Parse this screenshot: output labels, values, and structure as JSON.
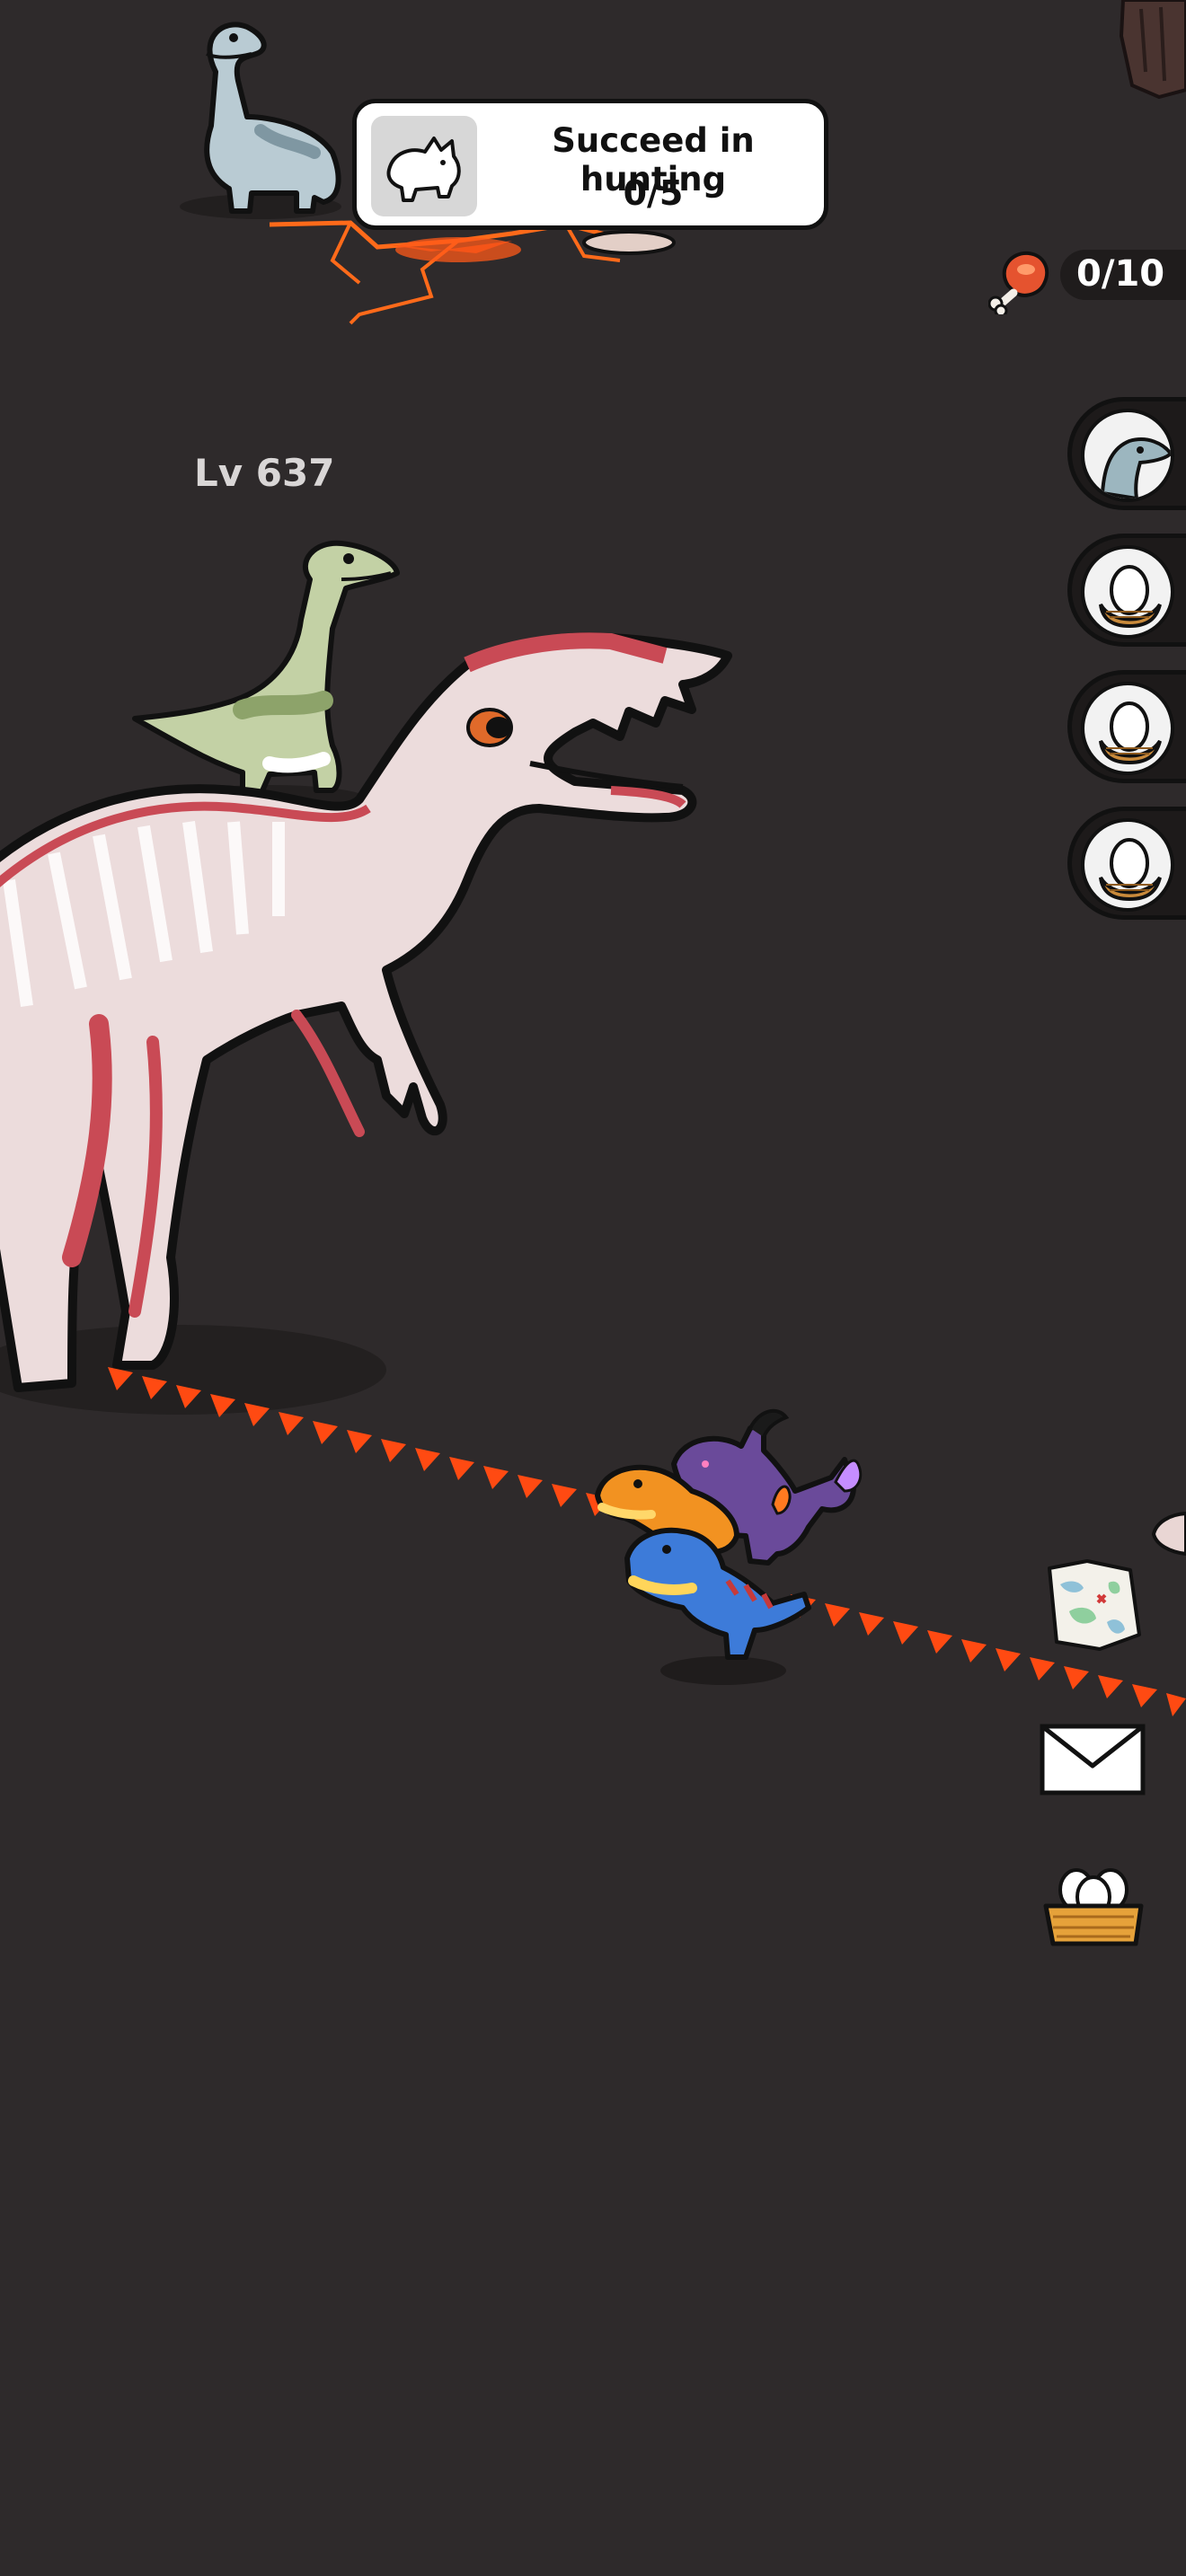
{
  "quest": {
    "title": "Succeed in hunting",
    "progress": "0/5",
    "icon": "triceratops-icon"
  },
  "resources": {
    "meat_icon": "meat-icon",
    "meat_count": "0/10"
  },
  "enemy": {
    "level_label": "Lv 637",
    "species_icon": "spinosaurus"
  },
  "side_slots": [
    {
      "icon": "dino-head-icon"
    },
    {
      "icon": "egg-nest-icon"
    },
    {
      "icon": "egg-nest-icon"
    },
    {
      "icon": "egg-nest-icon"
    }
  ],
  "side_buttons": [
    {
      "icon": "map-icon"
    },
    {
      "icon": "mail-icon"
    },
    {
      "icon": "nest-icon"
    }
  ],
  "colors": {
    "background": "#2e2a2b",
    "path_arrow": "#ff4a12",
    "lava": "#ff5a1a"
  }
}
